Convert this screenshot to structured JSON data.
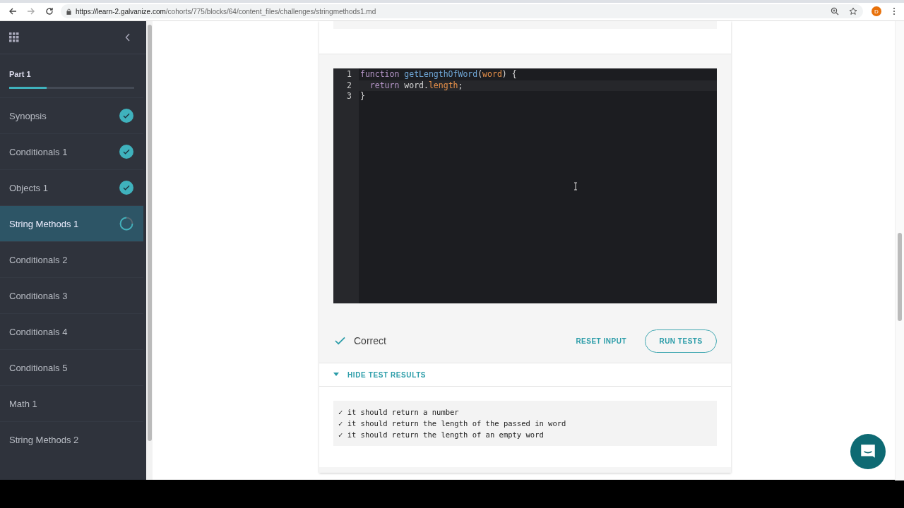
{
  "browser": {
    "url_host": "https://learn-2.galvanize.com",
    "url_path": "/cohorts/775/blocks/64/content_files/challenges/stringmethods1.md",
    "profile": "D"
  },
  "sidebar": {
    "section": "Part 1",
    "level": 0.3,
    "items": [
      {
        "label": "Synopsis",
        "completed": true,
        "in_progress": false,
        "selected": false
      },
      {
        "label": "Conditionals 1",
        "completed": true,
        "in_progress": false,
        "selected": false
      },
      {
        "label": "Objects 1",
        "completed": true,
        "in_progress": false,
        "selected": false
      },
      {
        "label": "String Methods 1",
        "completed": false,
        "in_progress": true,
        "selected": true
      },
      {
        "label": "Conditionals 2",
        "completed": false,
        "in_progress": false,
        "selected": false
      },
      {
        "label": "Conditionals 3",
        "completed": false,
        "in_progress": false,
        "selected": false
      },
      {
        "label": "Conditionals 4",
        "completed": false,
        "in_progress": false,
        "selected": false
      },
      {
        "label": "Conditionals 5",
        "completed": false,
        "in_progress": false,
        "selected": false
      },
      {
        "label": "Math 1",
        "completed": false,
        "in_progress": false,
        "selected": false
      },
      {
        "label": "String Methods 2",
        "completed": false,
        "in_progress": false,
        "selected": false
      }
    ]
  },
  "editor": {
    "lines": [
      {
        "number": "1",
        "tokens": [
          {
            "kind": "keyword",
            "text": "function "
          },
          {
            "kind": "name",
            "text": "getLengthOfWord"
          },
          {
            "kind": "plain",
            "text": "("
          },
          {
            "kind": "param",
            "text": "word"
          },
          {
            "kind": "plain",
            "text": ") {"
          }
        ]
      },
      {
        "number": "2",
        "tokens": [
          {
            "kind": "keyword",
            "text": "  return "
          },
          {
            "kind": "plain",
            "text": "word."
          },
          {
            "kind": "param",
            "text": "length"
          },
          {
            "kind": "plain",
            "text": ";"
          }
        ]
      },
      {
        "number": "3",
        "tokens": [
          {
            "kind": "plain",
            "text": "}"
          }
        ]
      }
    ]
  },
  "result": {
    "status": "Correct",
    "reset": "RESET INPUT",
    "run": "RUN TESTS"
  },
  "tests": {
    "toggle": "HIDE TEST RESULTS",
    "expanded": true,
    "items": [
      "✓ it should return a number",
      "✓ it should return the length of the passed in word",
      "✓ it should return the length of an empty word"
    ]
  }
}
